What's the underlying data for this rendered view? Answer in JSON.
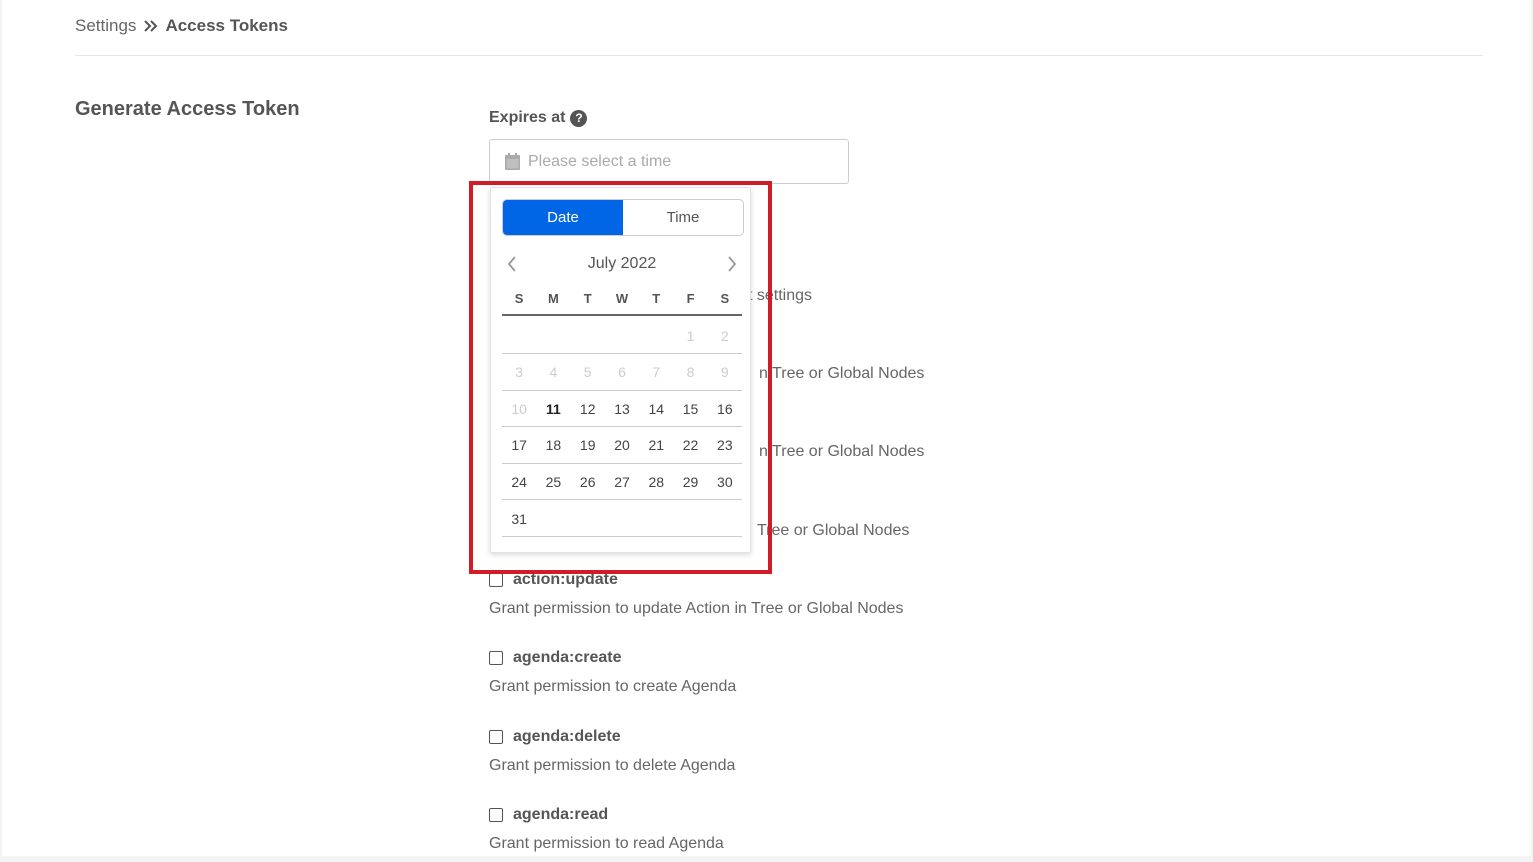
{
  "breadcrumb": {
    "parent": "Settings",
    "current": "Access Tokens"
  },
  "section_title": "Generate Access Token",
  "expires": {
    "label": "Expires at",
    "help_icon": "question-circle-icon",
    "placeholder": "Please select a time",
    "input_icon": "calendar-icon"
  },
  "picker": {
    "tabs": [
      "Date",
      "Time"
    ],
    "active_tab": "Date",
    "month_label": "July 2022",
    "weekdays": [
      "S",
      "M",
      "T",
      "W",
      "T",
      "F",
      "S"
    ],
    "weeks": [
      [
        "",
        "",
        "",
        "",
        "",
        "1",
        "2"
      ],
      [
        "3",
        "4",
        "5",
        "6",
        "7",
        "8",
        "9"
      ],
      [
        "10",
        "11",
        "12",
        "13",
        "14",
        "15",
        "16"
      ],
      [
        "17",
        "18",
        "19",
        "20",
        "21",
        "22",
        "23"
      ],
      [
        "24",
        "25",
        "26",
        "27",
        "28",
        "29",
        "30"
      ],
      [
        "31",
        "",
        "",
        "",
        "",
        "",
        ""
      ]
    ],
    "disabled_through": "10",
    "today": "11"
  },
  "obscured_fragments": [
    "t settings",
    "n Tree or Global Nodes",
    "n Tree or Global Nodes",
    "Tree or Global Nodes"
  ],
  "permissions": [
    {
      "name": "action:update",
      "desc": "Grant permission to update Action in Tree or Global Nodes"
    },
    {
      "name": "agenda:create",
      "desc": "Grant permission to create Agenda"
    },
    {
      "name": "agenda:delete",
      "desc": "Grant permission to delete Agenda"
    },
    {
      "name": "agenda:read",
      "desc": "Grant permission to read Agenda"
    }
  ]
}
